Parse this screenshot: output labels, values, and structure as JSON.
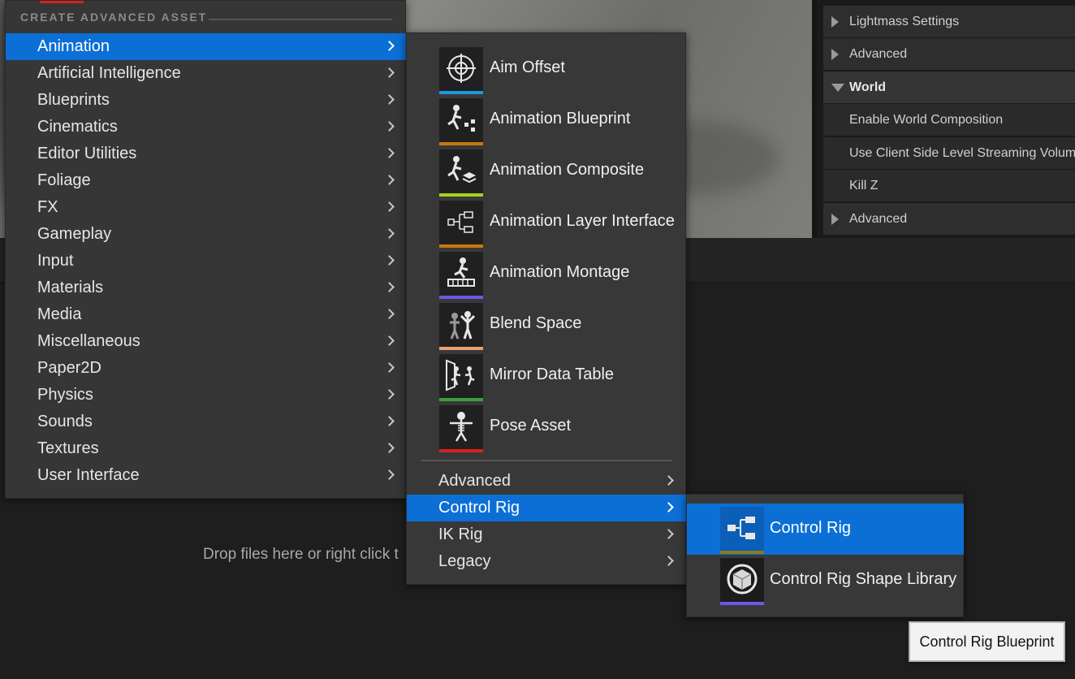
{
  "details": {
    "rows": [
      {
        "label": "Lightmass Settings",
        "kind": "collapsed"
      },
      {
        "label": "Advanced",
        "kind": "collapsed"
      },
      {
        "label": "World",
        "kind": "expanded"
      },
      {
        "label": "Enable World Composition",
        "kind": "property"
      },
      {
        "label": "Use Client Side Level Streaming Volumes",
        "kind": "property"
      },
      {
        "label": "Kill Z",
        "kind": "property"
      },
      {
        "label": "Advanced",
        "kind": "collapsed"
      }
    ]
  },
  "content_browser": {
    "drop_hint": "Drop files here or right click t"
  },
  "main_menu": {
    "header": "CREATE ADVANCED ASSET",
    "items": [
      {
        "label": "Animation",
        "selected": true
      },
      {
        "label": "Artificial Intelligence"
      },
      {
        "label": "Blueprints"
      },
      {
        "label": "Cinematics"
      },
      {
        "label": "Editor Utilities"
      },
      {
        "label": "Foliage"
      },
      {
        "label": "FX"
      },
      {
        "label": "Gameplay"
      },
      {
        "label": "Input"
      },
      {
        "label": "Materials"
      },
      {
        "label": "Media"
      },
      {
        "label": "Miscellaneous"
      },
      {
        "label": "Paper2D"
      },
      {
        "label": "Physics"
      },
      {
        "label": "Sounds"
      },
      {
        "label": "Textures"
      },
      {
        "label": "User Interface"
      }
    ]
  },
  "animation_menu": {
    "assets": [
      {
        "label": "Aim Offset",
        "icon": "aim-offset-icon",
        "color": "#1a9be0"
      },
      {
        "label": "Animation Blueprint",
        "icon": "animation-blueprint-icon",
        "color": "#c8780a"
      },
      {
        "label": "Animation Composite",
        "icon": "animation-composite-icon",
        "color": "#a6d21e"
      },
      {
        "label": "Animation Layer Interface",
        "icon": "animation-layer-interface-icon",
        "color": "#c8780a"
      },
      {
        "label": "Animation Montage",
        "icon": "animation-montage-icon",
        "color": "#6a5ae8"
      },
      {
        "label": "Blend Space",
        "icon": "blend-space-icon",
        "color": "#e8a070"
      },
      {
        "label": "Mirror Data Table",
        "icon": "mirror-data-table-icon",
        "color": "#3aa03a"
      },
      {
        "label": "Pose Asset",
        "icon": "pose-asset-icon",
        "color": "#d82020"
      }
    ],
    "submenus": [
      {
        "label": "Advanced"
      },
      {
        "label": "Control Rig",
        "selected": true
      },
      {
        "label": "IK Rig"
      },
      {
        "label": "Legacy"
      }
    ]
  },
  "control_rig_menu": {
    "items": [
      {
        "label": "Control Rig",
        "icon": "control-rig-icon",
        "color": "#8a7a20",
        "selected": true
      },
      {
        "label": "Control Rig Shape Library",
        "icon": "shape-library-icon",
        "color": "#6a5ae8"
      }
    ]
  },
  "tooltip": {
    "text": "Control Rig Blueprint"
  }
}
